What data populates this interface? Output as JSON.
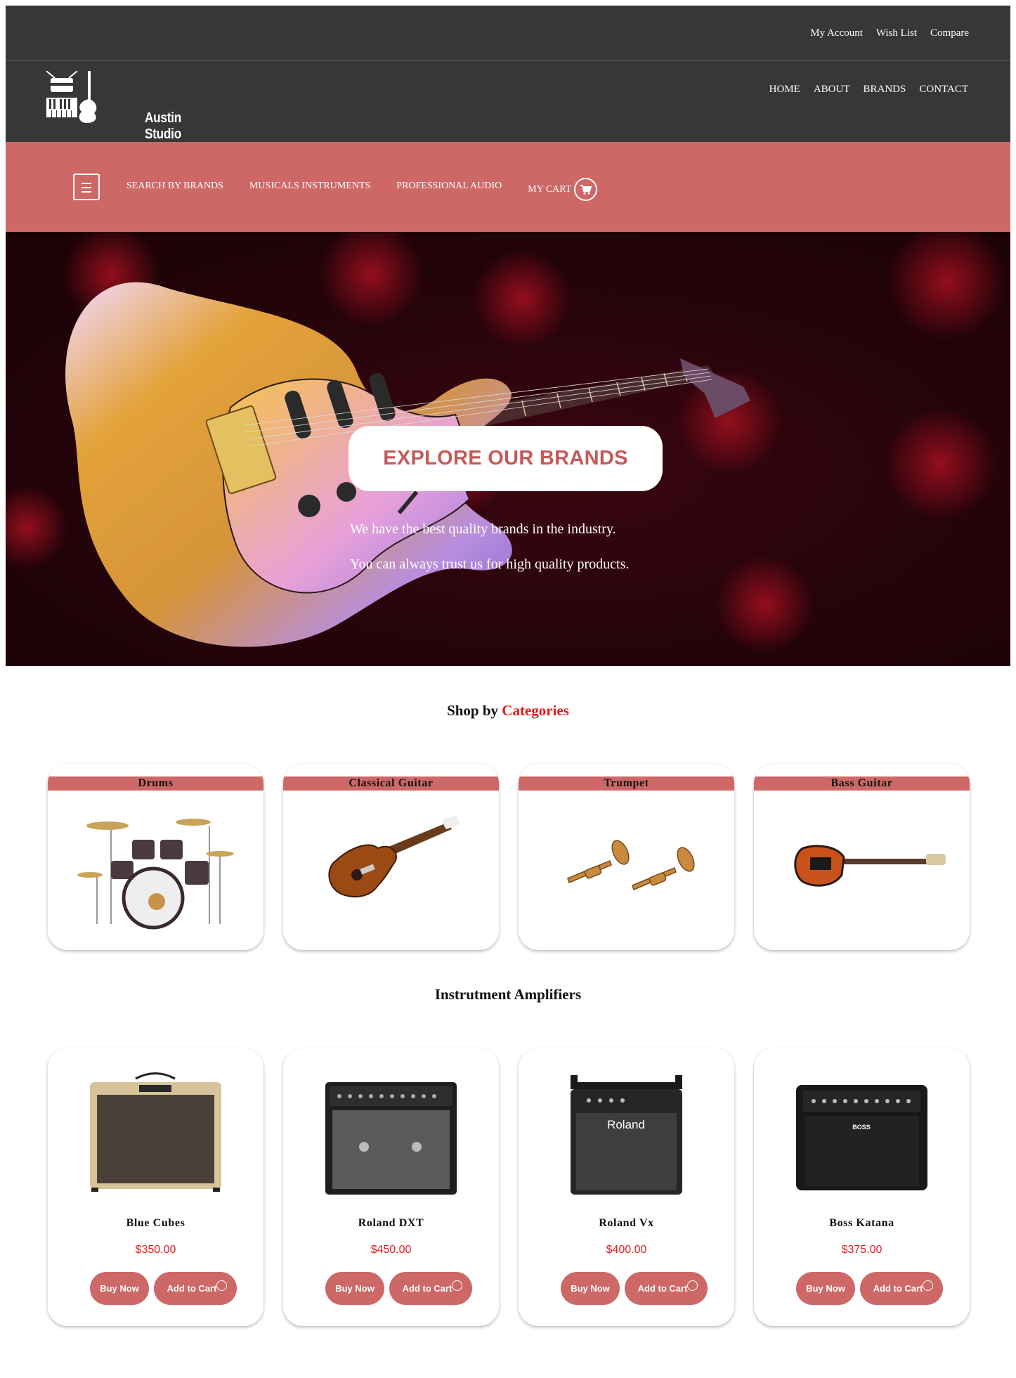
{
  "topbar": {
    "links": [
      "My Account",
      "Wish List",
      "Compare"
    ]
  },
  "header": {
    "logo_text": "Austin Studio",
    "nav": [
      "HOME",
      "ABOUT",
      "BRANDS",
      "CONTACT"
    ]
  },
  "catbar": {
    "links": [
      "SEARCH BY BRANDS",
      "MUSICALS INSTRUMENTS",
      "PROFESSIONAL AUDIO"
    ],
    "cart_label": "MY CART"
  },
  "hero": {
    "cta": "EXPLORE OUR BRANDS",
    "line1": "We have the best quality brands in the industry.",
    "line2": "You can always trust us for high quality products."
  },
  "categories": {
    "title_prefix": "Shop by",
    "title_accent": "Categories",
    "items": [
      {
        "name": "Drums"
      },
      {
        "name": "Classical Guitar"
      },
      {
        "name": "Trumpet"
      },
      {
        "name": "Bass Guitar"
      }
    ]
  },
  "amplifiers": {
    "title": "Instrutment Amplifiers",
    "items": [
      {
        "name": "Blue Cubes",
        "price": "$350.00",
        "buy": "Buy Now",
        "cart": "Add to Cart"
      },
      {
        "name": "Roland DXT",
        "price": "$450.00",
        "buy": "Buy Now",
        "cart": "Add to Cart"
      },
      {
        "name": "Roland Vx",
        "price": "$400.00",
        "buy": "Buy Now",
        "cart": "Add to Cart"
      },
      {
        "name": "Boss Katana",
        "price": "$375.00",
        "buy": "Buy Now",
        "cart": "Add to Cart"
      }
    ]
  },
  "amp_labels": {
    "roland": "Roland",
    "boss": "BOSS"
  },
  "colors": {
    "dark": "#373737",
    "accent_band": "#cd6866",
    "price": "#e31b1b",
    "title_accent": "#e11b1b"
  }
}
